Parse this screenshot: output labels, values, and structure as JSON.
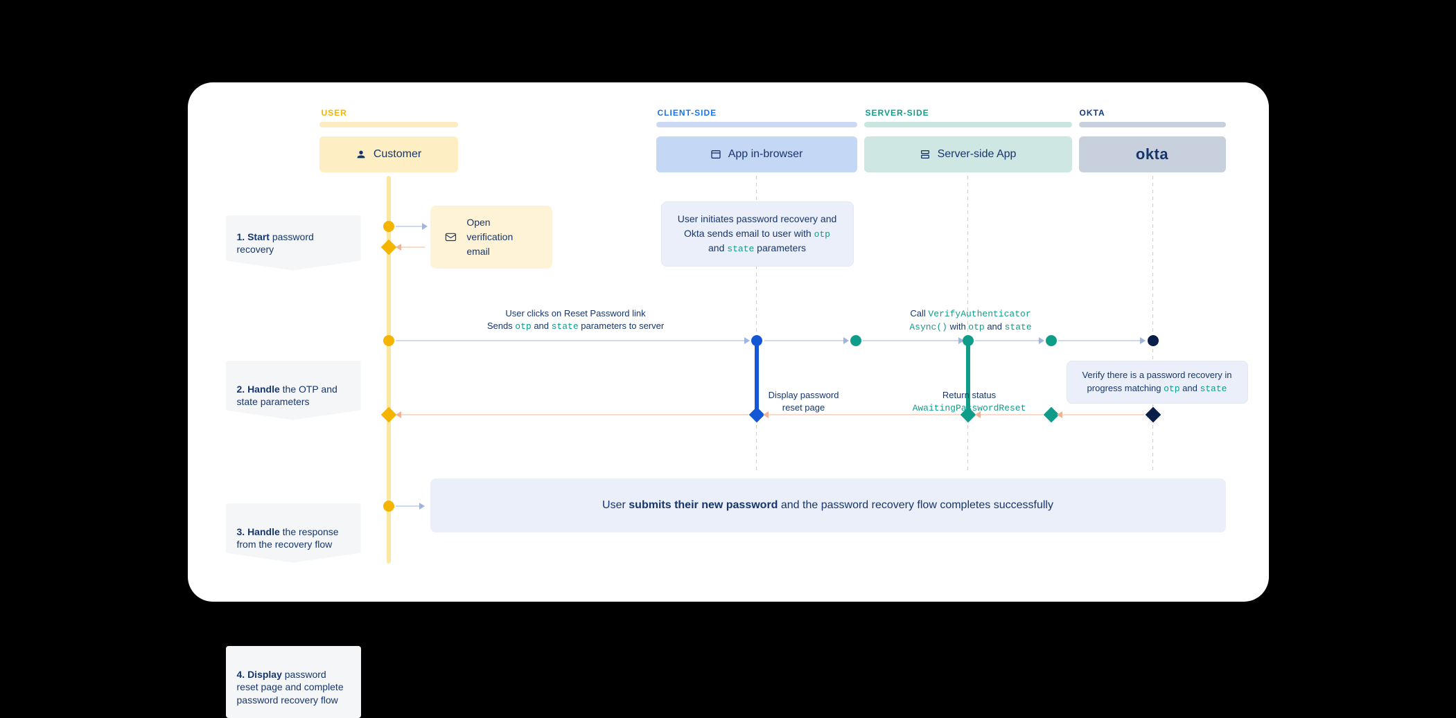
{
  "lanes": {
    "user": {
      "label": "USER",
      "box": "Customer"
    },
    "client": {
      "label": "CLIENT-SIDE",
      "box": "App in-browser"
    },
    "server": {
      "label": "SERVER-SIDE",
      "box": "Server-side App"
    },
    "okta": {
      "label": "OKTA",
      "box": "okta"
    }
  },
  "steps": {
    "s1_bold": "1. Start",
    "s1_rest": " password recovery",
    "s2_bold": "2. Handle",
    "s2_rest": " the OTP and state parameters",
    "s3_bold": "3. Handle",
    "s3_rest": " the response from the recovery flow",
    "s4_bold": "4. Display",
    "s4_rest": " password reset page and complete password recovery flow"
  },
  "email_note": "Open verification email",
  "client_note_pre": "User initiates password recovery and Okta sends email to user with ",
  "client_note_code1": "otp",
  "client_note_mid": " and ",
  "client_note_code2": "state",
  "client_note_post": " parameters",
  "arrow1_line1": "User clicks on Reset Password link",
  "arrow1_line2_pre": "Sends ",
  "arrow1_code1": "otp",
  "arrow1_mid": " and ",
  "arrow1_code2": "state",
  "arrow1_post": " parameters to server",
  "arrow2_pre": "Call ",
  "arrow2_code1": "VerifyAuthenticator",
  "arrow2_code2": "Async()",
  "arrow2_mid": " with ",
  "arrow2_code3": "otp",
  "arrow2_and": " and ",
  "arrow2_code4": "state",
  "okta_note_pre": "Verify there is a password recovery in progress matching ",
  "okta_note_code1": "otp",
  "okta_note_mid": " and ",
  "okta_note_code2": "state",
  "return1_line1": "Return status",
  "return1_code": "AwaitingPasswordReset",
  "return2_line1": "Display password",
  "return2_line2": "reset page",
  "final_pre": "User ",
  "final_bold": "submits their new password",
  "final_post": " and the password recovery flow completes successfully"
}
